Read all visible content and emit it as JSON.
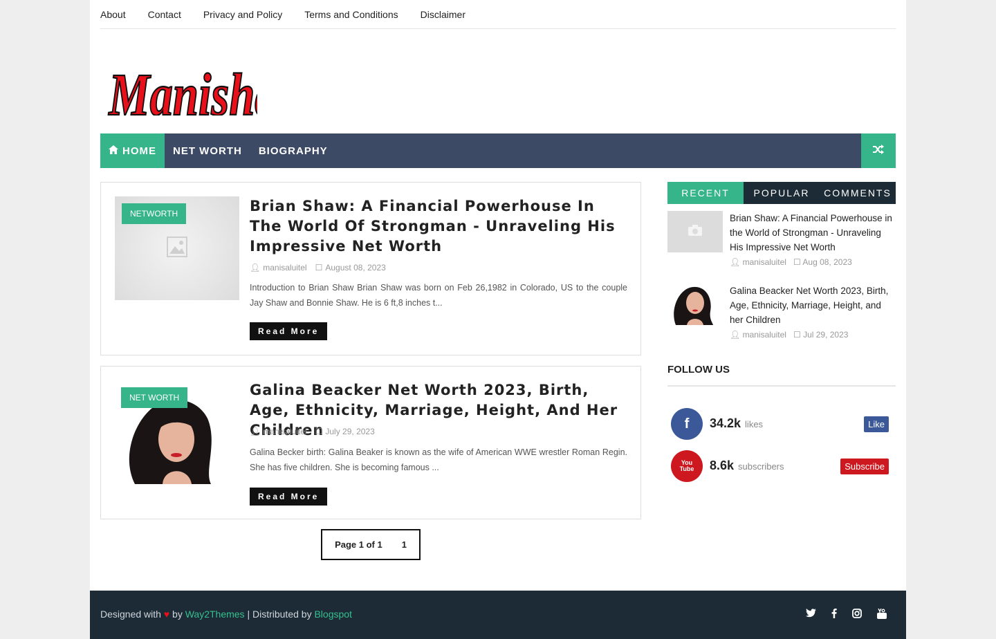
{
  "topnav": {
    "items": [
      "About",
      "Contact",
      "Privacy and Policy",
      "Terms and Conditions",
      "Disclaimer"
    ]
  },
  "logo": {
    "text": "Manisha"
  },
  "mainnav": {
    "items": [
      "HOME",
      "NET WORTH",
      "BIOGRAPHY"
    ],
    "active_index": 0,
    "home_icon": "home-icon",
    "shuffle_icon": "random-icon"
  },
  "posts": [
    {
      "label": "NETWORTH",
      "title": "Brian Shaw: A Financial Powerhouse In The World Of Strongman - Unraveling His Impressive Net Worth",
      "author": "manisaluitel",
      "date": "August 08, 2023",
      "excerpt": "Introduction to Brian Shaw  Brian Shaw was born on Feb 26,1982 in Colorado, US to the couple Jay Shaw and Bonnie Shaw. He is 6 ft,8 inches t...",
      "read_more": "Read More",
      "thumb_icon": "image-placeholder-icon"
    },
    {
      "label": "NET WORTH",
      "title": "Galina Beacker Net Worth 2023, Birth, Age, Ethnicity, Marriage, Height, And Her Children",
      "author": "manisaluitel",
      "date": "July 29, 2023",
      "excerpt": "Galina Becker birth: Galina Beaker is known as the wife of American WWE wrestler Roman Regin. She has five children. She is becoming famous ...",
      "read_more": "Read More",
      "thumb_icon": "portrait-photo"
    }
  ],
  "pager": {
    "summary": "Page 1 of 1",
    "current": "1"
  },
  "sidebar": {
    "tabs": [
      "Recent",
      "Popular",
      "Comments"
    ],
    "active_tab": 0,
    "recent": [
      {
        "title": "Brian Shaw: A Financial Powerhouse in the World of Strongman - Unraveling His Impressive Net Worth",
        "author": "manisaluitel",
        "date": "Aug 08, 2023"
      },
      {
        "title": "Galina Beacker Net Worth 2023, Birth, Age, Ethnicity, Marriage, Height, and her Children",
        "author": "manisaluitel",
        "date": "Jul 29, 2023"
      }
    ],
    "follow_heading": "FOLLOW US",
    "social": [
      {
        "network": "facebook",
        "icon": "f",
        "count": "34.2k",
        "unit": "likes",
        "button": "Like",
        "color": "#3b5998"
      },
      {
        "network": "youtube",
        "icon": "You Tube",
        "count": "8.6k",
        "unit": "subscribers",
        "button": "Subscribe",
        "color": "#cc181e"
      }
    ]
  },
  "footer": {
    "designed_with": "Designed with",
    "by": "by",
    "way2themes": "Way2Themes",
    "distributed": "| Distributed by",
    "blogspot": "Blogspot",
    "icons": [
      "twitter-icon",
      "facebook-icon",
      "instagram-icon",
      "youtube-icon"
    ]
  },
  "colors": {
    "accent": "#36b58b",
    "nav": "#3c4a66",
    "dark": "#1c2b36"
  }
}
